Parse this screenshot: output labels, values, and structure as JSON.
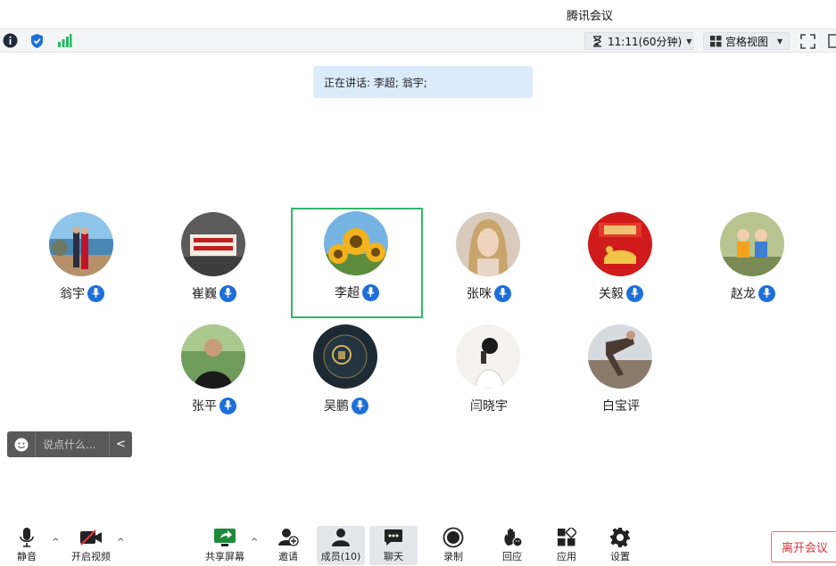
{
  "window": {
    "title": "腾讯会议"
  },
  "meeting": {
    "timer": "11:11(60分钟)",
    "view_mode": "宫格视图",
    "speaking": "正在讲话: 李超; 翁宇;"
  },
  "participants": [
    {
      "name": "翁宇",
      "mic": true
    },
    {
      "name": "崔巍",
      "mic": true
    },
    {
      "name": "李超",
      "mic": true,
      "active": true
    },
    {
      "name": "张咪",
      "mic": true
    },
    {
      "name": "关毅",
      "mic": true
    },
    {
      "name": "赵龙",
      "mic": true
    },
    {
      "name": "张平",
      "mic": true
    },
    {
      "name": "吴鹏",
      "mic": true
    },
    {
      "name": "闫晓宇",
      "mic": false
    },
    {
      "name": "白宝评",
      "mic": false
    }
  ],
  "chat": {
    "placeholder": "说点什么..."
  },
  "toolbar": {
    "mute": "静音",
    "video": "开启视频",
    "share": "共享屏幕",
    "invite": "邀请",
    "members": "成员(10)",
    "chat": "聊天",
    "record": "录制",
    "react": "回应",
    "apps": "应用",
    "settings": "设置",
    "leave": "离开会议"
  },
  "colors": {
    "accent_blue": "#1e6fd9",
    "active_green": "#2fb866",
    "leave_red": "#d9363e",
    "speaking_bg": "#dcebfb"
  },
  "icons": {
    "info": "info-icon",
    "shield": "shield-icon",
    "signal": "signal-icon",
    "hourglass": "hourglass-icon",
    "grid": "grid-icon",
    "fullscreen": "fullscreen-icon",
    "mic": "mic-icon",
    "camera_off": "camera-off-icon",
    "share": "share-screen-icon",
    "invite": "add-user-icon",
    "members": "members-icon",
    "chat": "chat-icon",
    "record": "record-icon",
    "react": "wave-hand-icon",
    "apps": "apps-icon",
    "settings": "gear-icon"
  }
}
